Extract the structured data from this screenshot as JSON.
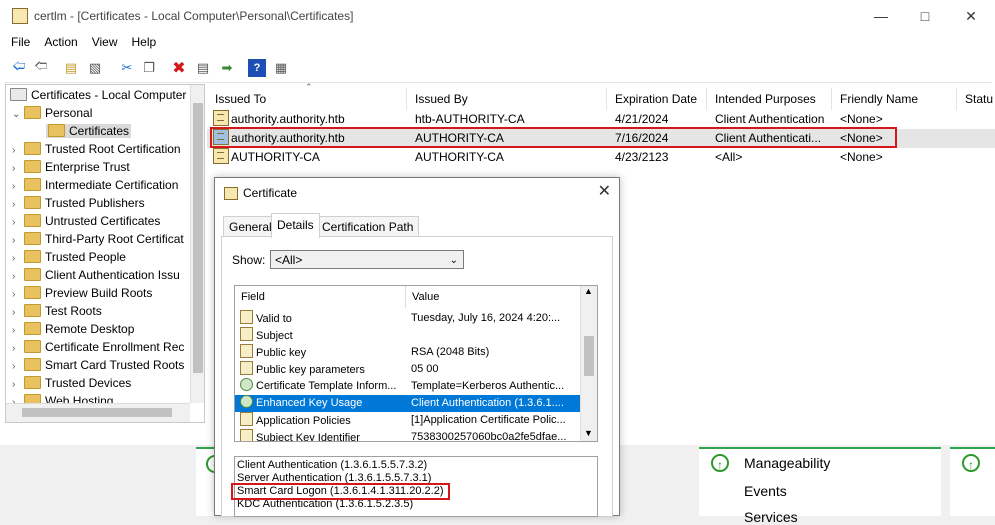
{
  "window": {
    "title": "certlm - [Certificates - Local Computer\\Personal\\Certificates]"
  },
  "menu": [
    "File",
    "Action",
    "View",
    "Help"
  ],
  "toolbar_icons": [
    "back-arrow-icon",
    "forward-arrow-icon",
    "up-folder-icon",
    "show-hide-tree-icon",
    "cut-icon",
    "copy-icon",
    "delete-icon",
    "properties-icon",
    "export-list-icon",
    "help-icon",
    "view-icon"
  ],
  "tree": {
    "root": "Certificates - Local Computer",
    "personal": "Personal",
    "certificates": "Certificates",
    "items": [
      "Trusted Root Certification",
      "Enterprise Trust",
      "Intermediate Certification",
      "Trusted Publishers",
      "Untrusted Certificates",
      "Third-Party Root Certificat",
      "Trusted People",
      "Client Authentication Issu",
      "Preview Build Roots",
      "Test Roots",
      "Remote Desktop",
      "Certificate Enrollment Rec",
      "Smart Card Trusted Roots",
      "Trusted Devices",
      "Web Hosting"
    ]
  },
  "list": {
    "columns": [
      "Issued To",
      "Issued By",
      "Expiration Date",
      "Intended Purposes",
      "Friendly Name",
      "Statu"
    ],
    "rows": [
      [
        "authority.authority.htb",
        "htb-AUTHORITY-CA",
        "4/21/2024",
        "Client Authentication",
        "<None>"
      ],
      [
        "authority.authority.htb",
        "AUTHORITY-CA",
        "7/16/2024",
        "Client Authenticati...",
        "<None>"
      ],
      [
        "AUTHORITY-CA",
        "AUTHORITY-CA",
        "4/23/2123",
        "<All>",
        "<None>"
      ]
    ]
  },
  "dialog": {
    "title": "Certificate",
    "tabs": [
      "General",
      "Details",
      "Certification Path"
    ],
    "show_label": "Show:",
    "show_value": "<All>",
    "field_header": "Field",
    "value_header": "Value",
    "fields": [
      [
        "Valid to",
        "Tuesday, July 16, 2024 4:20:..."
      ],
      [
        "Subject",
        ""
      ],
      [
        "Public key",
        "RSA (2048 Bits)"
      ],
      [
        "Public key parameters",
        "05 00"
      ],
      [
        "Certificate Template Inform...",
        "Template=Kerberos Authentic..."
      ],
      [
        "Enhanced Key Usage",
        "Client Authentication (1.3.6.1...."
      ],
      [
        "Application Policies",
        "[1]Application Certificate Polic..."
      ],
      [
        "Subject Key Identifier",
        "7538300257060bc0a2fe5dfae..."
      ]
    ],
    "value_lines": [
      "Client Authentication (1.3.6.1.5.5.7.3.2)",
      "Server Authentication (1.3.6.1.5.5.7.3.1)",
      "Smart Card Logon (1.3.6.1.4.1.311.20.2.2)",
      "KDC Authentication (1.3.6.1.5.2.3.5)"
    ]
  },
  "background": {
    "manageability": "Manageability",
    "events": "Events",
    "services": "Services"
  }
}
